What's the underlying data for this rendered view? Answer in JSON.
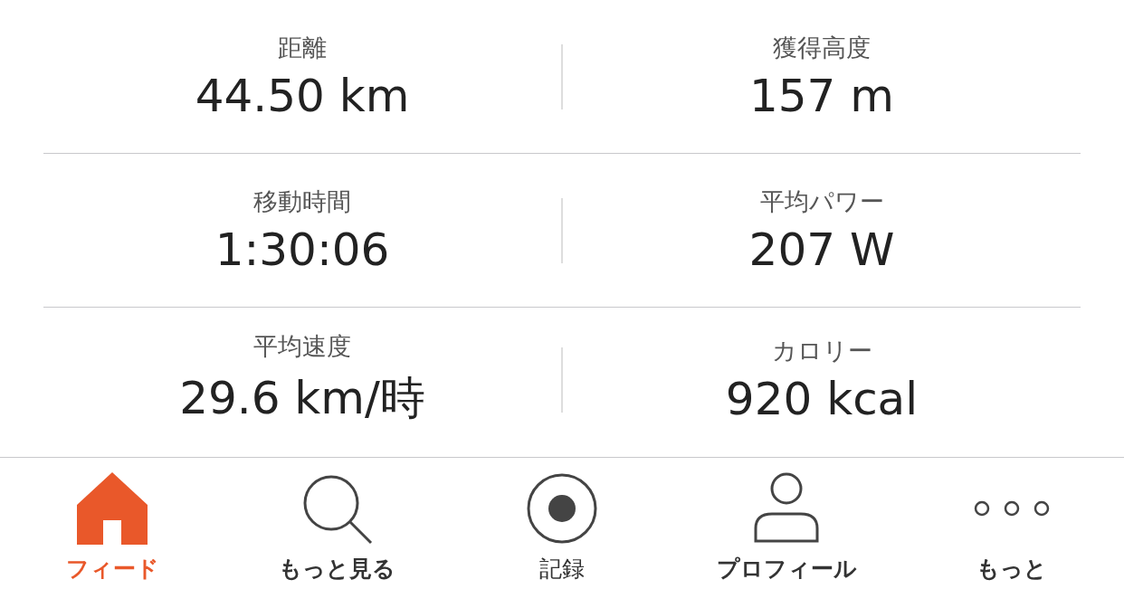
{
  "stats": [
    {
      "label": "距離",
      "value": "44.50 km"
    },
    {
      "label": "獲得高度",
      "value": "157 m"
    },
    {
      "label": "移動時間",
      "value": "1:30:06"
    },
    {
      "label": "平均パワー",
      "value": "207 W"
    },
    {
      "label": "平均速度",
      "value": "29.6 km/時"
    },
    {
      "label": "カロリー",
      "value": "920 kcal"
    }
  ],
  "tab_bar": [
    {
      "kind": "home",
      "label": "フィード",
      "selected": true
    },
    {
      "kind": "search",
      "label": "もっと見る",
      "selected": false
    },
    {
      "kind": "record",
      "label": "記録",
      "selected": false
    },
    {
      "kind": "profile",
      "label": "プロフィール",
      "selected": false
    },
    {
      "kind": "more",
      "label": "もっと",
      "selected": false
    }
  ]
}
